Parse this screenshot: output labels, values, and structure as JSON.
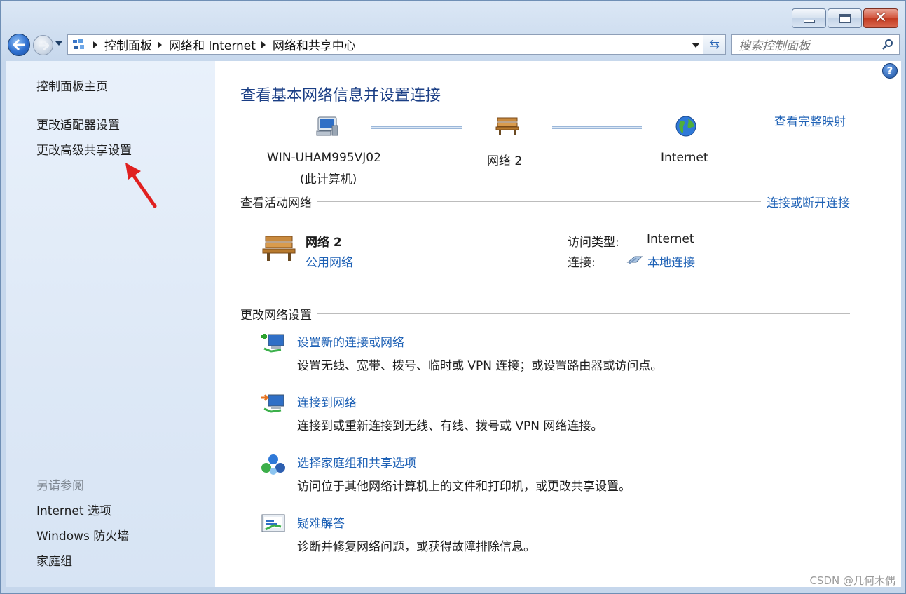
{
  "window": {
    "caption_buttons": [
      "minimize",
      "maximize",
      "close"
    ]
  },
  "navbar": {
    "breadcrumbs": [
      "控制面板",
      "网络和 Internet",
      "网络和共享中心"
    ],
    "search_placeholder": "搜索控制面板"
  },
  "leftpane": {
    "home_link": "控制面板主页",
    "links": [
      "更改适配器设置",
      "更改高级共享设置"
    ],
    "see_also_header": "另请参阅",
    "see_also": [
      "Internet 选项",
      "Windows 防火墙",
      "家庭组"
    ]
  },
  "main": {
    "title": "查看基本网络信息并设置连接",
    "view_full_map": "查看完整映射",
    "map": {
      "computer_name": "WIN-UHAM995VJ02",
      "computer_sub": "(此计算机)",
      "network_name": "网络  2",
      "internet_label": "Internet"
    },
    "active_networks": {
      "header": "查看活动网络",
      "connect_disconnect": "连接或断开连接",
      "network_name": "网络  2",
      "network_type": "公用网络",
      "access_type_label": "访问类型:",
      "access_type_value": "Internet",
      "connection_label": "连接:",
      "connection_value": "本地连接"
    },
    "change_settings": {
      "header": "更改网络设置",
      "tasks": [
        {
          "title": "设置新的连接或网络",
          "desc": "设置无线、宽带、拨号、临时或 VPN 连接；或设置路由器或访问点。"
        },
        {
          "title": "连接到网络",
          "desc": "连接到或重新连接到无线、有线、拨号或 VPN 网络连接。"
        },
        {
          "title": "选择家庭组和共享选项",
          "desc": "访问位于其他网络计算机上的文件和打印机，或更改共享设置。"
        },
        {
          "title": "疑难解答",
          "desc": "诊断并修复网络问题，或获得故障排除信息。"
        }
      ]
    }
  },
  "watermark": "CSDN @几何木偶",
  "colors": {
    "link": "#1f62b6",
    "title": "#1a3e85",
    "annotation_arrow": "#e02020"
  }
}
